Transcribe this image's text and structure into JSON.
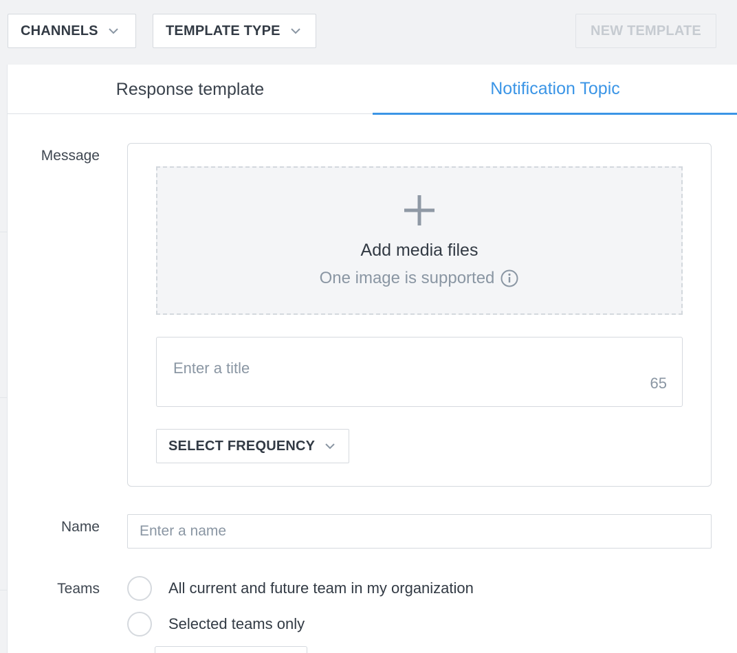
{
  "toolbar": {
    "channels_label": "CHANNELS",
    "template_type_label": "TEMPLATE TYPE",
    "new_template_label": "NEW TEMPLATE"
  },
  "tabs": [
    {
      "label": "Response template",
      "active": false
    },
    {
      "label": "Notification Topic",
      "active": true
    }
  ],
  "form": {
    "message_label": "Message",
    "media": {
      "title": "Add media files",
      "subtitle": "One image is supported"
    },
    "title_input": {
      "placeholder": "Enter a title",
      "value": "",
      "char_count": "65"
    },
    "frequency_label": "SELECT FREQUENCY",
    "name_label": "Name",
    "name_input": {
      "placeholder": "Enter a name",
      "value": ""
    },
    "teams_label": "Teams",
    "teams_options": [
      {
        "label": "All current and future team in my organization",
        "selected": false
      },
      {
        "label": "Selected teams only",
        "selected": false
      }
    ]
  },
  "colors": {
    "accent": "#3b95e6",
    "text": "#323a44",
    "muted": "#8a96a3",
    "border": "#d5d9de",
    "background": "#f1f2f4"
  }
}
